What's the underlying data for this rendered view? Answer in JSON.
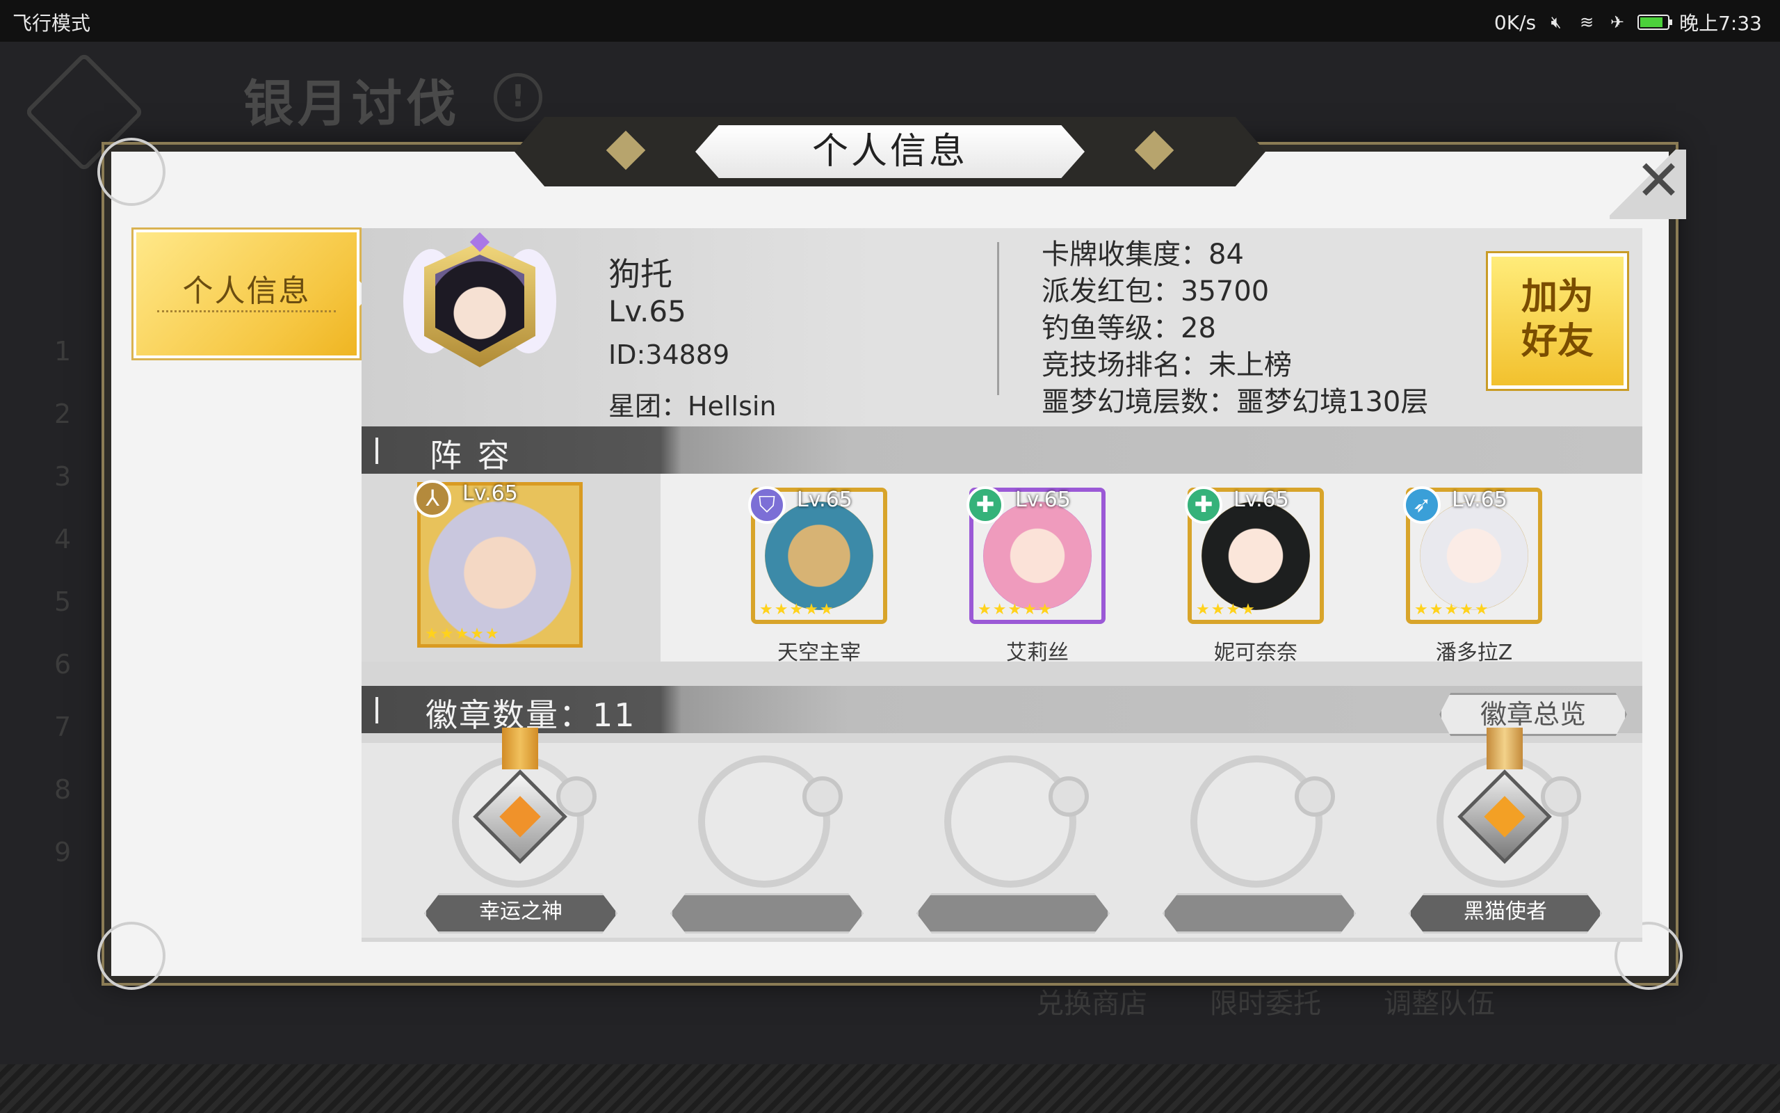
{
  "status_bar": {
    "left_text": "飞行模式",
    "network_speed": "0K/s",
    "time": "晚上7:33",
    "icons": [
      "mute-icon",
      "wifi-icon",
      "airplane-icon",
      "battery-icon"
    ],
    "battery_level": 0.8
  },
  "background": {
    "title": "银月讨伐",
    "rank_numbers": [
      "1",
      "2",
      "3",
      "4",
      "5",
      "6",
      "7",
      "8",
      "9"
    ],
    "bottom_nav": [
      "兑换商店",
      "限时委托",
      "调整队伍"
    ]
  },
  "dialog": {
    "title": "个人信息",
    "side_tab_label": "个人信息",
    "player": {
      "name": "狗托",
      "level": "Lv.65",
      "id": "ID:34889",
      "guild": "星团：Hellsin"
    },
    "stats": [
      "卡牌收集度：84",
      "派发红包：35700",
      "钓鱼等级：28",
      "竞技场排名：未上榜",
      "噩梦幻境层数：噩梦幻境130层"
    ],
    "add_friend_line1": "加为",
    "add_friend_line2": "好友",
    "lineup_title": "阵 容",
    "leader": {
      "level": "Lv.65",
      "stars": "★★★★★",
      "class_icon": "hand-icon"
    },
    "heroes": [
      {
        "name": "天空主宰",
        "level": "Lv.65",
        "stars": "★★★★★",
        "class_icon": "shield-icon",
        "badge_color": "#7c6fd6",
        "frame_color": "#d8a42a"
      },
      {
        "name": "艾莉丝",
        "level": "Lv.65",
        "stars": "★★★★★",
        "class_icon": "cross-icon",
        "badge_color": "#35b27a",
        "frame_color": "#9b59d6"
      },
      {
        "name": "妮可奈奈",
        "level": "Lv.65",
        "stars": "★★★★",
        "class_icon": "cross-icon",
        "badge_color": "#35b27a",
        "frame_color": "#d8a42a"
      },
      {
        "name": "潘多拉Z",
        "level": "Lv.65",
        "stars": "★★★★★",
        "class_icon": "bow-icon",
        "badge_color": "#3a9fd8",
        "frame_color": "#d8a42a"
      }
    ],
    "badge_title": "徽章数量：11",
    "badge_overview_label": "徽章总览",
    "badges": [
      {
        "name": "幸运之神",
        "filled": true
      },
      {
        "name": "",
        "filled": false
      },
      {
        "name": "",
        "filled": false
      },
      {
        "name": "",
        "filled": false
      },
      {
        "name": "黑猫使者",
        "filled": true
      }
    ],
    "close_icon": "close-icon"
  }
}
